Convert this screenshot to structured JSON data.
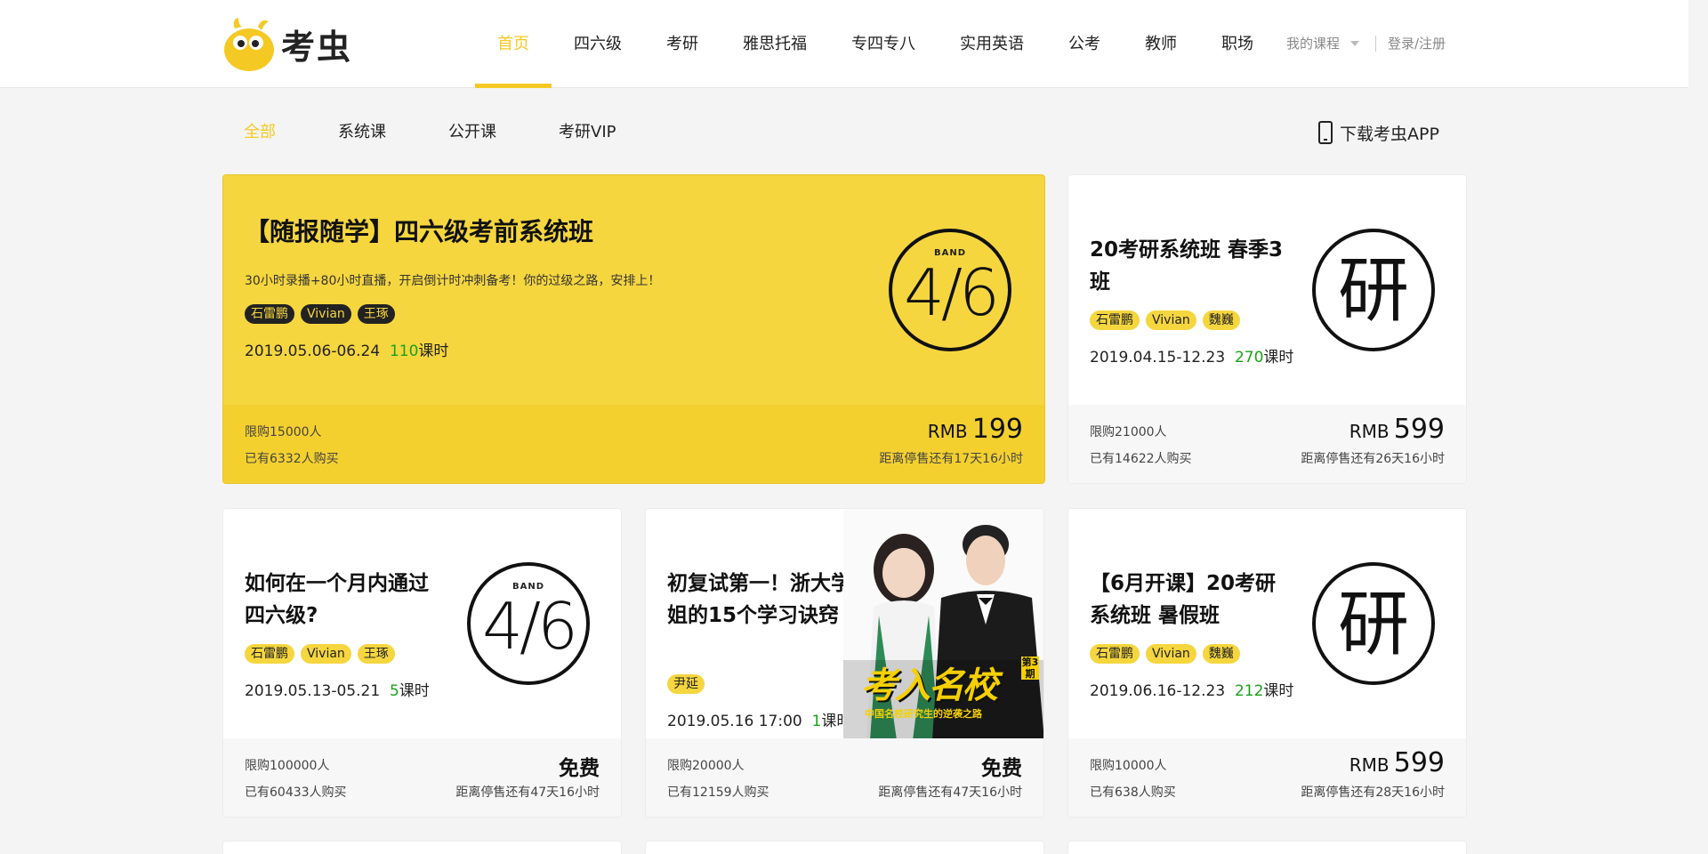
{
  "header": {
    "brand": "考虫",
    "nav": [
      "首页",
      "四六级",
      "考研",
      "雅思托福",
      "专四专八",
      "实用英语",
      "公考",
      "教师",
      "职场"
    ],
    "active_nav": "首页",
    "my_courses": "我的课程",
    "login": "登录/注册"
  },
  "filters": {
    "items": [
      "全部",
      "系统课",
      "公开课",
      "考研VIP"
    ],
    "active": "全部",
    "download_app": "下载考虫APP"
  },
  "cards": [
    {
      "title": "【随报随学】四六级考前系统班",
      "desc": "30小时录播+80小时直播，开启倒计时冲刺备考！你的过级之路，安排上！",
      "tags": [
        "石雷鹏",
        "Vivian",
        "王琢"
      ],
      "date": "2019.05.06-06.24",
      "hours": "110",
      "hours_unit": "课时",
      "limit": "限购15000人",
      "bought": "已有6332人购买",
      "price_currency": "RMB",
      "price": "199",
      "countdown": "距离停售还有17天16小时",
      "badge_band": "BAND",
      "badge_text": "4/6"
    },
    {
      "title": "20考研系统班 春季3班",
      "tags": [
        "石雷鹏",
        "Vivian",
        "魏巍"
      ],
      "date": "2019.04.15-12.23",
      "hours": "270",
      "hours_unit": "课时",
      "limit": "限购21000人",
      "bought": "已有14622人购买",
      "price_currency": "RMB",
      "price": "599",
      "countdown": "距离停售还有26天16小时",
      "badge_text": "研"
    },
    {
      "title": "如何在一个月内通过四六级?",
      "tags": [
        "石雷鹏",
        "Vivian",
        "王琢"
      ],
      "date": "2019.05.13-05.21",
      "hours": "5",
      "hours_unit": "课时",
      "limit": "限购100000人",
      "bought": "已有60433人购买",
      "price_text": "免费",
      "countdown": "距离停售还有47天16小时",
      "badge_band": "BAND",
      "badge_text": "4/6"
    },
    {
      "title": "初复试第一！浙大学姐的15个学习诀窍",
      "tags": [
        "尹延"
      ],
      "date": "2019.05.16 17:00",
      "hours": "1",
      "hours_unit": "课时",
      "limit": "限购20000人",
      "bought": "已有12159人购买",
      "price_text": "免费",
      "countdown": "距离停售还有47天16小时",
      "poster_title": "考入名校",
      "poster_vol": "第3期",
      "poster_sub": "中国名校研究生的逆袭之路"
    },
    {
      "title": "【6月开课】20考研系统班 暑假班",
      "tags": [
        "石雷鹏",
        "Vivian",
        "魏巍"
      ],
      "date": "2019.06.16-12.23",
      "hours": "212",
      "hours_unit": "课时",
      "limit": "限购10000人",
      "bought": "已有638人购买",
      "price_currency": "RMB",
      "price": "599",
      "countdown": "距离停售还有28天16小时",
      "badge_text": "研"
    }
  ],
  "colors": {
    "brand_yellow": "#f5c924",
    "featured_bg": "#f5d63f",
    "hours_green": "#1aa11a"
  }
}
